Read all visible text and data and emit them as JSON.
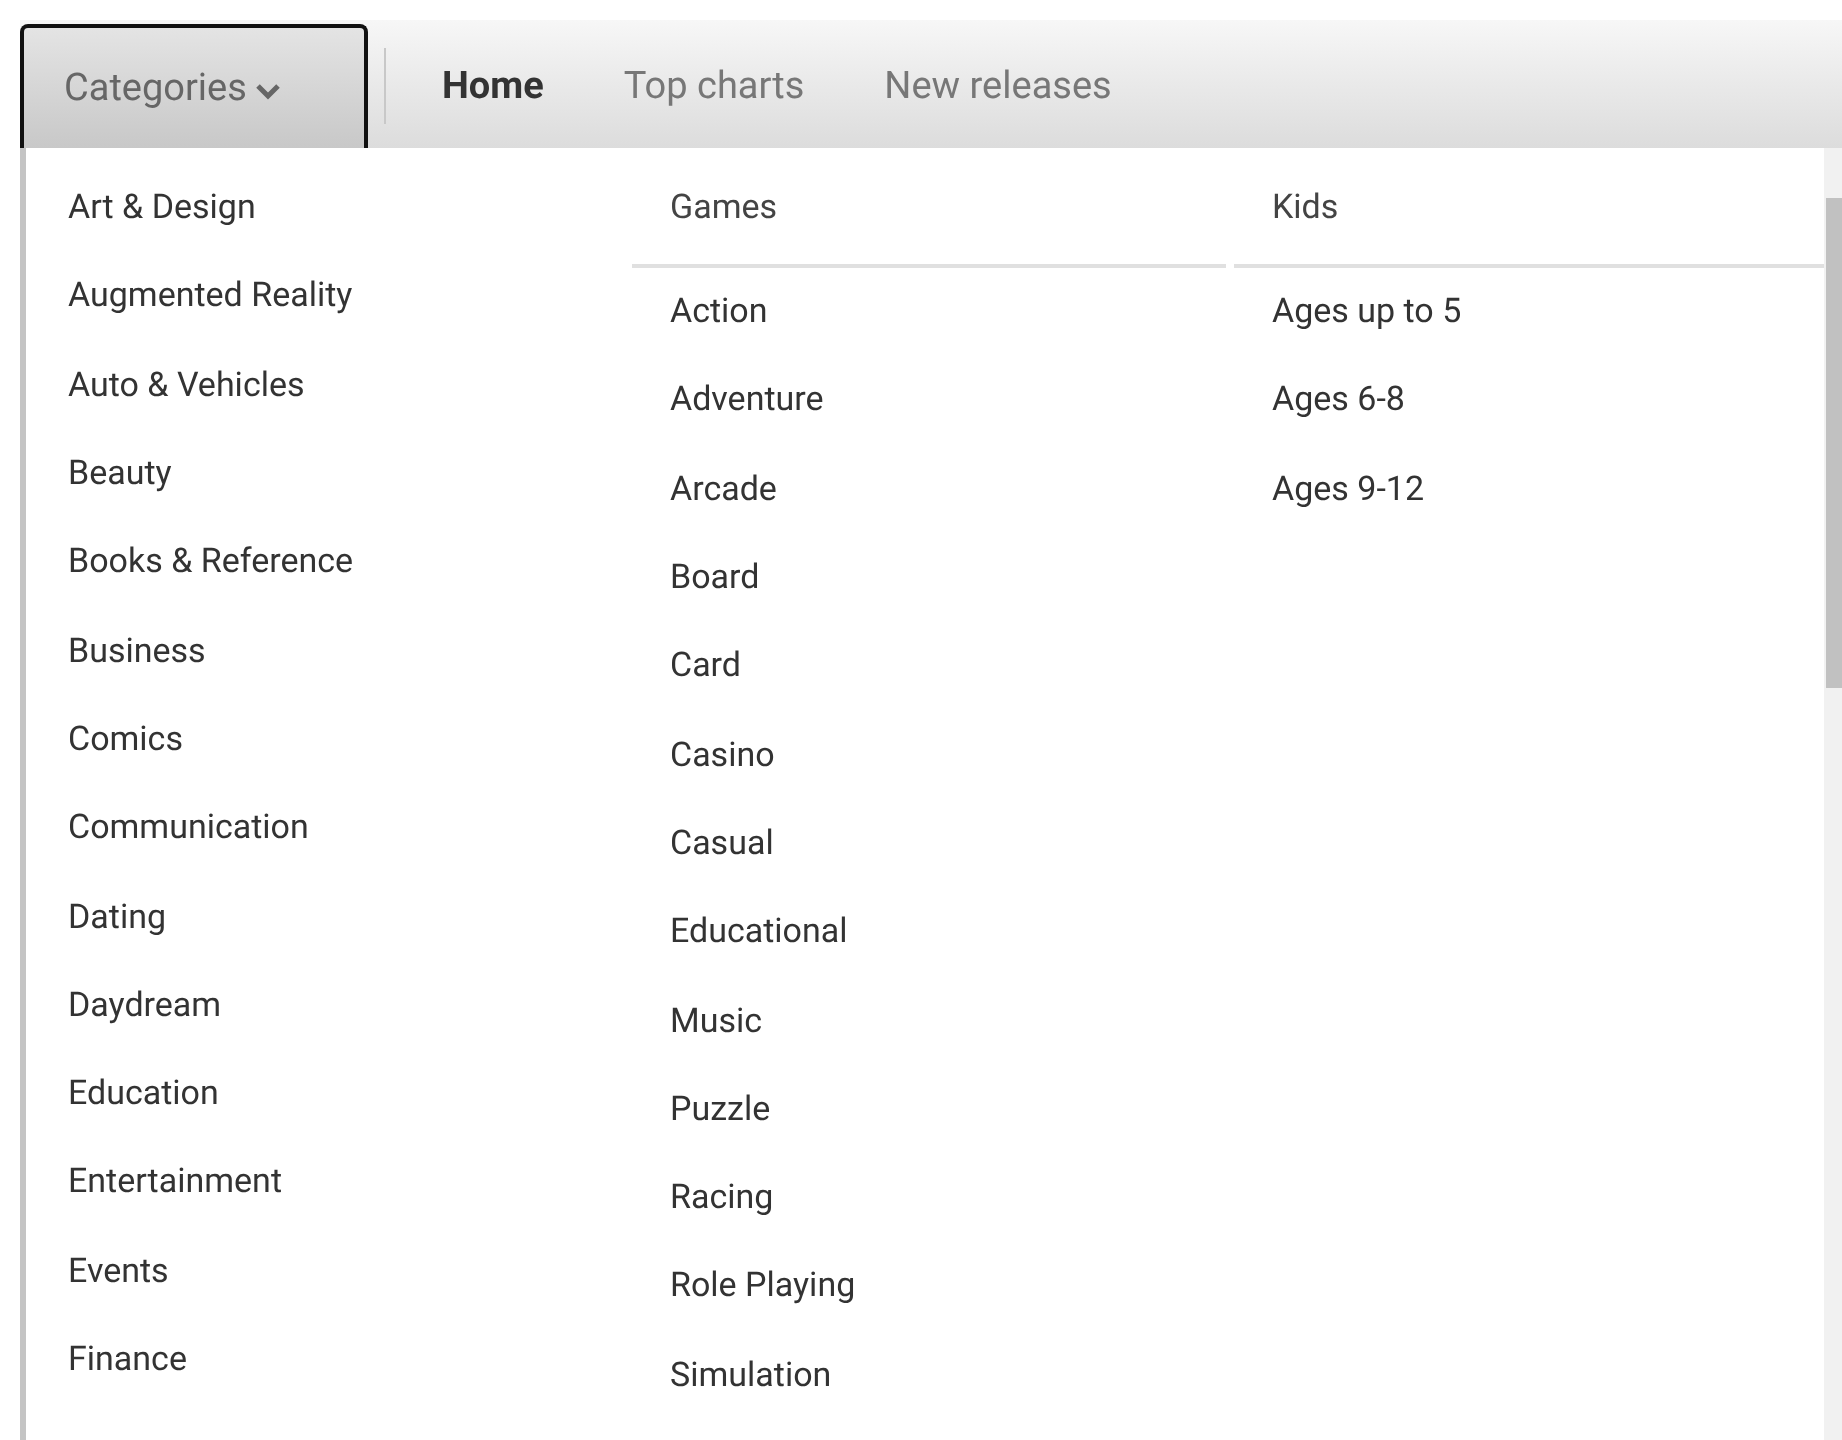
{
  "nav": {
    "categories": {
      "label": "Categories",
      "expanded": true
    },
    "tabs": [
      {
        "label": "Home",
        "selected": true
      },
      {
        "label": "Top charts",
        "selected": false
      },
      {
        "label": "New releases",
        "selected": false
      }
    ]
  },
  "menu": {
    "columns": [
      {
        "items": [
          "Art & Design",
          "Augmented Reality",
          "Auto & Vehicles",
          "Beauty",
          "Books & Reference",
          "Business",
          "Comics",
          "Communication",
          "Dating",
          "Daydream",
          "Education",
          "Entertainment",
          "Events",
          "Finance"
        ]
      },
      {
        "heading": "Games",
        "items": [
          "Action",
          "Adventure",
          "Arcade",
          "Board",
          "Card",
          "Casino",
          "Casual",
          "Educational",
          "Music",
          "Puzzle",
          "Racing",
          "Role Playing",
          "Simulation"
        ]
      },
      {
        "heading": "Kids",
        "items": [
          "Ages up to 5",
          "Ages 6-8",
          "Ages 9-12"
        ]
      }
    ]
  }
}
